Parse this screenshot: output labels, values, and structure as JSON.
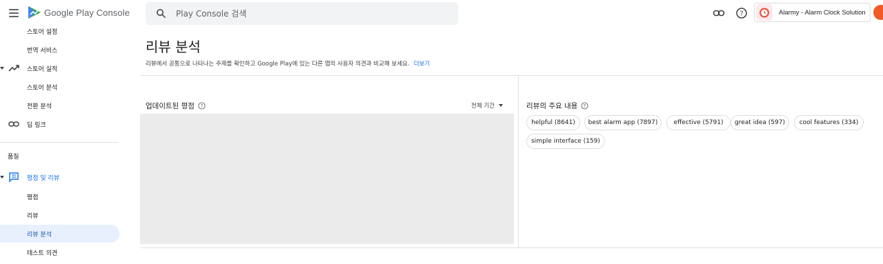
{
  "header": {
    "logo_text": "Google Play Console",
    "search_placeholder": "Play Console 검색",
    "app_name": "Alarmy - Alarm Clock Solution"
  },
  "sidebar": {
    "items": [
      {
        "label": "스토어 설정"
      },
      {
        "label": "번역 서비스"
      },
      {
        "label": "스토어 실적"
      },
      {
        "label": "스토어 분석"
      },
      {
        "label": "전환 분석"
      },
      {
        "label": "딥 링크"
      },
      {
        "label": "평점 및 리뷰"
      },
      {
        "label": "평점"
      },
      {
        "label": "리뷰"
      },
      {
        "label": "리뷰 분석"
      },
      {
        "label": "테스트 의견"
      }
    ],
    "section_quality": "품질"
  },
  "main": {
    "title": "리뷰 분석",
    "description": "리뷰에서 공통으로 나타나는 주제를 확인하고 Google Play에 있는 다른 앱의 사용자 의견과 비교해 보세요.",
    "learn_more": "더보기",
    "ratings_card": {
      "title": "업데이트된 평점",
      "period": "전체 기간"
    },
    "topics_card": {
      "title": "리뷰의 주요 내용",
      "chips": [
        "helpful (8641)",
        "best alarm app (7897)",
        "effective (5791)",
        "great idea (597)",
        "cool features (334)",
        "simple interface (159)"
      ]
    }
  },
  "colors": {
    "accent": "#1a73e8",
    "selected_bg": "#e8f0fe",
    "chart_placeholder": "#ebebeb"
  }
}
